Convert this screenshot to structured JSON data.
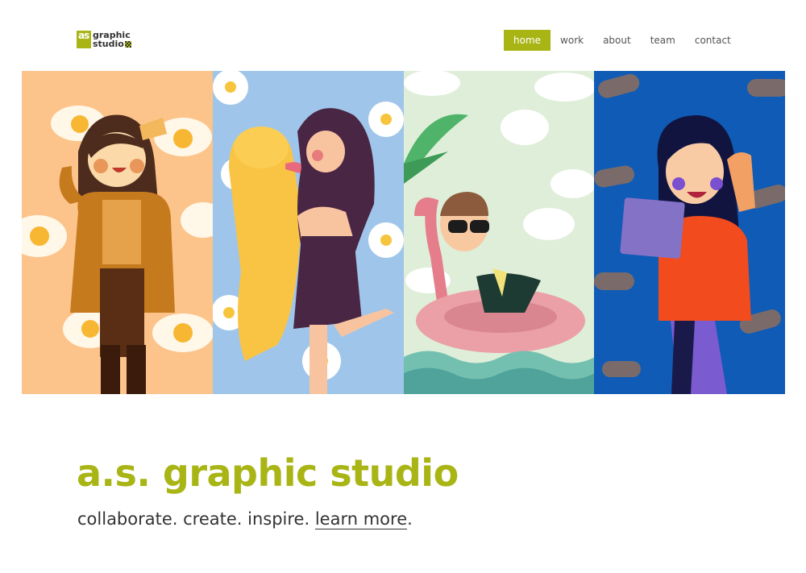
{
  "logo": {
    "mark": "as",
    "line1": "graphic",
    "line2": "studio"
  },
  "nav": [
    {
      "label": "home",
      "active": true
    },
    {
      "label": "work",
      "active": false
    },
    {
      "label": "about",
      "active": false
    },
    {
      "label": "team",
      "active": false
    },
    {
      "label": "contact",
      "active": false
    }
  ],
  "gallery": {
    "panels": [
      {
        "background": "#fcc48a",
        "subject": "girl-with-eggs"
      },
      {
        "background": "#9fc6ea",
        "subject": "girl-with-dog"
      },
      {
        "background": "#dfeed9",
        "subject": "boy-on-flamingo-float"
      },
      {
        "background": "#0f5bb5",
        "subject": "girl-with-laptop"
      }
    ]
  },
  "hero": {
    "title": "a.s. graphic studio",
    "tagline_prefix": "collaborate. create. inspire.",
    "tagline_link": "learn more",
    "tagline_suffix": "."
  },
  "colors": {
    "accent": "#a8b515",
    "text": "#333333"
  }
}
